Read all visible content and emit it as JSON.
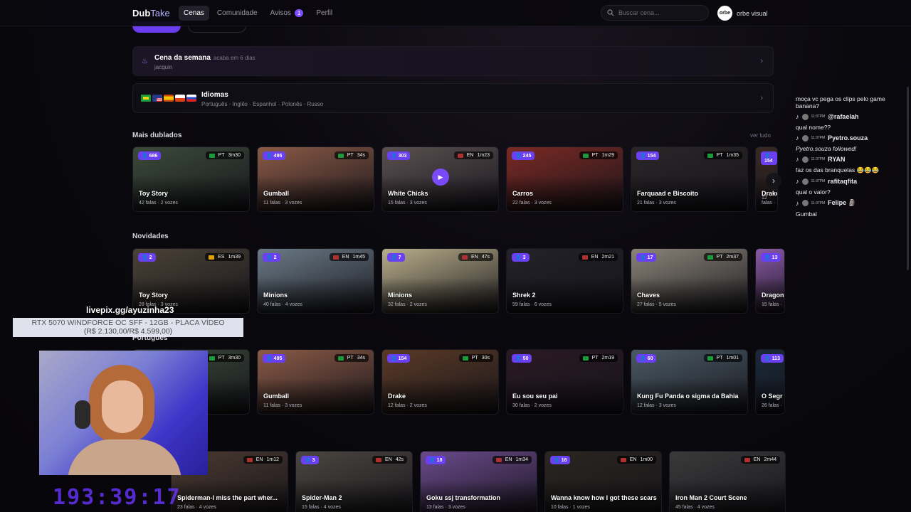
{
  "app": {
    "logo_part1": "Dub",
    "logo_part2": "Take"
  },
  "nav": {
    "items": [
      {
        "label": "Cenas",
        "active": true
      },
      {
        "label": "Comunidade"
      },
      {
        "label": "Avisos",
        "badge": "1"
      },
      {
        "label": "Perfil"
      }
    ]
  },
  "search": {
    "placeholder": "Buscar cena..."
  },
  "user": {
    "avatar_text": "orbe",
    "name": "orbe visual"
  },
  "cena_semana": {
    "title": "Cena da semana",
    "sub": "acaba em 6 dias",
    "desc": "jacquin"
  },
  "idiomas": {
    "title": "Idiomas",
    "desc": "Português · Inglês · Espanhol · Polonês · Russo"
  },
  "sections": {
    "mais_dublados": {
      "title": "Mais dublados",
      "see_all": "ver tudo",
      "items": [
        {
          "count": "686",
          "lang": "PT",
          "duration": "3m30",
          "title": "Toy Story",
          "falas": "42 falas",
          "vozes": "2 vozes",
          "color": "#3b4a3a"
        },
        {
          "count": "495",
          "lang": "PT",
          "duration": "34s",
          "title": "Gumball",
          "falas": "11 falas",
          "vozes": "3 vozes",
          "color": "#8a5a46"
        },
        {
          "count": "303",
          "lang": "EN",
          "duration": "1m23",
          "title": "White Chicks",
          "falas": "15 falas",
          "vozes": "3 vozes",
          "color": "#5a5050"
        },
        {
          "count": "245",
          "lang": "PT",
          "duration": "1m29",
          "title": "Carros",
          "falas": "22 falas",
          "vozes": "3 vozes",
          "color": "#7a2a24"
        },
        {
          "count": "154",
          "lang": "PT",
          "duration": "1m35",
          "title": "Farquaad e Biscoito",
          "falas": "21 falas",
          "vozes": "3 vozes",
          "color": "#2a2628"
        },
        {
          "count": "154",
          "lang": "",
          "duration": "",
          "title": "Drake",
          "falas": "12 falas",
          "vozes": "",
          "color": "#3a2a24"
        }
      ]
    },
    "novidades": {
      "title": "Novidades",
      "items": [
        {
          "count": "2",
          "lang": "ES",
          "duration": "1m39",
          "title": "Toy Story",
          "falas": "28 falas",
          "vozes": "3 vozes",
          "color": "#4a4236"
        },
        {
          "count": "2",
          "lang": "EN",
          "duration": "1m45",
          "title": "Minions",
          "falas": "40 falas",
          "vozes": "4 vozes",
          "color": "#6a7a86"
        },
        {
          "count": "7",
          "lang": "EN",
          "duration": "47s",
          "title": "Minions",
          "falas": "32 falas",
          "vozes": "2 vozes",
          "color": "#b8ae8a"
        },
        {
          "count": "3",
          "lang": "EN",
          "duration": "2m21",
          "title": "Shrek 2",
          "falas": "59 falas",
          "vozes": "6 vozes",
          "color": "#232228"
        },
        {
          "count": "17",
          "lang": "PT",
          "duration": "2m37",
          "title": "Chaves",
          "falas": "27 falas",
          "vozes": "5 vozes",
          "color": "#8a8478"
        },
        {
          "count": "13",
          "lang": "",
          "duration": "",
          "title": "Dragon",
          "falas": "15 falas",
          "vozes": "",
          "color": "#8a5aa4"
        }
      ]
    },
    "portugues": {
      "title": "Português",
      "items": [
        {
          "count": "",
          "lang": "PT",
          "duration": "3m30",
          "title": "",
          "falas": "",
          "vozes": "",
          "color": "#3b4a3a"
        },
        {
          "count": "495",
          "lang": "PT",
          "duration": "34s",
          "title": "Gumball",
          "falas": "11 falas",
          "vozes": "3 vozes",
          "color": "#8a5a46"
        },
        {
          "count": "154",
          "lang": "PT",
          "duration": "30s",
          "title": "Drake",
          "falas": "12 falas",
          "vozes": "2 vozes",
          "color": "#5a3a26"
        },
        {
          "count": "50",
          "lang": "PT",
          "duration": "2m19",
          "title": "Eu sou seu pai",
          "falas": "30 falas",
          "vozes": "2 vozes",
          "color": "#2a1a24"
        },
        {
          "count": "60",
          "lang": "PT",
          "duration": "1m01",
          "title": "Kung Fu Panda o sigma da Bahia",
          "falas": "12 falas",
          "vozes": "3 vozes",
          "color": "#4a5a64"
        },
        {
          "count": "113",
          "lang": "",
          "duration": "",
          "title": "O Segr",
          "falas": "26 falas",
          "vozes": "",
          "color": "#1a2a3a"
        }
      ]
    },
    "ingles": {
      "items": [
        {
          "count": "",
          "lang": "EN",
          "duration": "1m12",
          "title": "Spiderman-I miss the part wher...",
          "falas": "23 falas",
          "vozes": "4 vozes",
          "color": "#4a3a30"
        },
        {
          "count": "3",
          "lang": "EN",
          "duration": "42s",
          "title": "Spider-Man 2",
          "falas": "15 falas",
          "vozes": "4 vozes",
          "color": "#4a4640"
        },
        {
          "count": "18",
          "lang": "EN",
          "duration": "1m34",
          "title": "Goku ssj transformation",
          "falas": "13 falas",
          "vozes": "3 vozes",
          "color": "#6a4a8a"
        },
        {
          "count": "16",
          "lang": "EN",
          "duration": "1m00",
          "title": "Wanna know how I got these scars",
          "falas": "10 falas",
          "vozes": "1 vozes",
          "color": "#2a2620"
        },
        {
          "count": "",
          "lang": "EN",
          "duration": "2m44",
          "title": "Iron Man 2 Court Scene",
          "falas": "45 falas",
          "vozes": "4 vozes",
          "color": "#3a3a3a"
        }
      ]
    }
  },
  "chat": [
    {
      "type": "msg",
      "text": "moça vc pega os clips pelo game banana?"
    },
    {
      "type": "user",
      "time": "11:37PM",
      "name": "@rafaelah"
    },
    {
      "type": "msg",
      "text": "qual nome??"
    },
    {
      "type": "user",
      "time": "11:37PM",
      "name": "Pyetro.souza"
    },
    {
      "type": "italic",
      "text": "Pyetro.souza followed!"
    },
    {
      "type": "user",
      "time": "11:37PM",
      "name": "RYAN"
    },
    {
      "type": "msg",
      "text": "faz os das branquelas 😂😂😂"
    },
    {
      "type": "user",
      "time": "11:37PM",
      "name": "rafitaqfita"
    },
    {
      "type": "msg",
      "text": "qual o valor?"
    },
    {
      "type": "user",
      "time": "11:37PM",
      "name": "Felipe 🗿"
    },
    {
      "type": "msg",
      "text": "Gumbal"
    }
  ],
  "overlay": {
    "livepix": "livepix.gg/ayuzinha23",
    "promo_line1": "RTX 5070 WINDFORCE OC SFF - 12GB - PLACA VÍDEO",
    "promo_line2": "(R$ 2.130,00/R$ 4.599,00)",
    "timer": "193:39:17"
  }
}
